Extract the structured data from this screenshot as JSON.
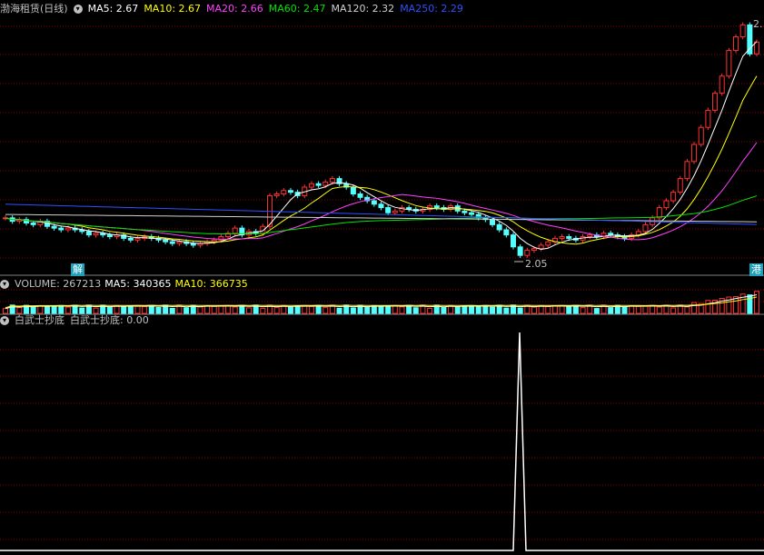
{
  "header_price": {
    "title": "渤海租赁(日线)",
    "ma": [
      {
        "label": "MA5: 2.67",
        "color": "#ffffff"
      },
      {
        "label": "MA10: 2.67",
        "color": "#ffff00"
      },
      {
        "label": "MA20: 2.66",
        "color": "#ff40ff"
      },
      {
        "label": "MA60: 2.47",
        "color": "#00e600"
      },
      {
        "label": "MA120: 2.32",
        "color": "#d0d0d0"
      },
      {
        "label": "MA250: 2.29",
        "color": "#3050ff"
      }
    ]
  },
  "header_volume": {
    "label": "VOLUME: 267213",
    "ma5": "MA5: 340365",
    "ma10": "MA10: 366735"
  },
  "header_indicator": {
    "name": "白武士抄底",
    "value_label": "白武士抄底: 0.00"
  },
  "annotations": {
    "low": "2.05",
    "high": "2.",
    "badge_left": "解",
    "badge_right": "港"
  },
  "colors": {
    "up": "#ff3030",
    "down": "#54ffff",
    "grid": "#8b0000",
    "indicator": "#ffffff"
  },
  "chart_data": [
    {
      "type": "candlestick",
      "title": "渤海租赁(日线)",
      "close": [
        2.32,
        2.3,
        2.31,
        2.29,
        2.28,
        2.3,
        2.27,
        2.26,
        2.25,
        2.26,
        2.25,
        2.24,
        2.22,
        2.23,
        2.22,
        2.21,
        2.22,
        2.2,
        2.19,
        2.2,
        2.21,
        2.2,
        2.19,
        2.18,
        2.17,
        2.18,
        2.17,
        2.16,
        2.17,
        2.18,
        2.19,
        2.21,
        2.23,
        2.26,
        2.22,
        2.24,
        2.23,
        2.27,
        2.45,
        2.46,
        2.48,
        2.47,
        2.45,
        2.5,
        2.52,
        2.51,
        2.53,
        2.55,
        2.52,
        2.5,
        2.46,
        2.44,
        2.42,
        2.4,
        2.38,
        2.35,
        2.36,
        2.38,
        2.37,
        2.36,
        2.37,
        2.39,
        2.38,
        2.37,
        2.39,
        2.36,
        2.35,
        2.34,
        2.32,
        2.31,
        2.28,
        2.25,
        2.22,
        2.15,
        2.1,
        2.13,
        2.14,
        2.16,
        2.18,
        2.2,
        2.21,
        2.2,
        2.19,
        2.21,
        2.22,
        2.21,
        2.23,
        2.22,
        2.21,
        2.2,
        2.22,
        2.24,
        2.28,
        2.32,
        2.38,
        2.42,
        2.47,
        2.55,
        2.65,
        2.75,
        2.85,
        2.95,
        3.05,
        3.15,
        3.3,
        3.38,
        3.45,
        3.28,
        3.35
      ],
      "ma5_last": 2.67,
      "ma10_last": 2.67,
      "ma20_last": 2.66,
      "ma60_last": 2.47,
      "ma120_last": 2.32,
      "ma250_last": 2.29,
      "low_marked": 2.05
    },
    {
      "type": "bar",
      "title": "VOLUME",
      "last": 267213,
      "ma5": 340365,
      "ma10": 366735
    },
    {
      "type": "line",
      "title": "白武士抄底",
      "last": 0.0
    }
  ]
}
